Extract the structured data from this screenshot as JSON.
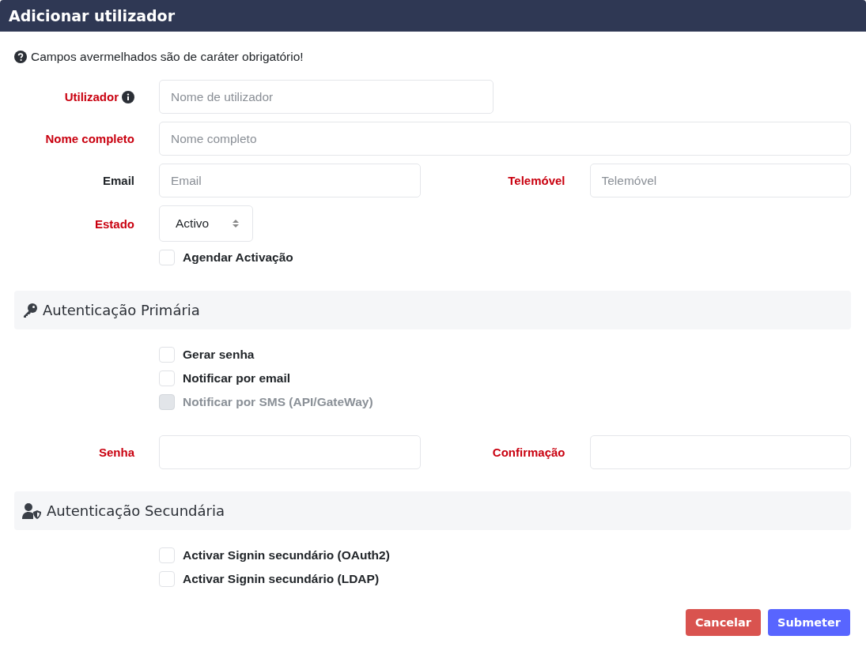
{
  "window": {
    "title": "Adicionar utilizador"
  },
  "note": "Campos avermelhados são de caráter obrigatório!",
  "rows": [
    {
      "kind": "short",
      "fields": [
        {
          "label": "Utilizador",
          "required": true,
          "info": true,
          "placeholder": "Nome de utilizador"
        }
      ]
    },
    {
      "kind": "full",
      "fields": [
        {
          "label": "Nome completo",
          "required": true,
          "placeholder": "Nome completo"
        }
      ]
    },
    {
      "kind": "pair",
      "fields": [
        {
          "label": "Email",
          "required": false,
          "placeholder": "Email"
        },
        {
          "label": "Telemóvel",
          "required": true,
          "placeholder": "Telemóvel"
        }
      ]
    },
    {
      "kind": "select",
      "fields": [
        {
          "label": "Estado",
          "required": true,
          "value": "Activo"
        }
      ]
    }
  ],
  "checkboxes": [
    {
      "label": "Agendar Activação",
      "checked": false,
      "disabled": false
    }
  ],
  "sections": [
    {
      "title": "Autenticação Primária",
      "checkboxes": [
        {
          "label": "Gerar senha",
          "checked": false,
          "disabled": false
        },
        {
          "label": "Notificar por email",
          "checked": false,
          "disabled": false
        },
        {
          "label": "Notificar por SMS (API/GateWay)",
          "checked": false,
          "disabled": true
        }
      ],
      "rows": [
        {
          "kind": "pair",
          "fields": [
            {
              "label": "Senha",
              "required": true
            },
            {
              "label": "Confirmação",
              "required": true
            }
          ]
        }
      ]
    },
    {
      "title": "Autenticação Secundária",
      "checkboxes": [
        {
          "label": "Activar Signin secundário (OAuth2)",
          "checked": false,
          "disabled": false
        },
        {
          "label": "Activar Signin secundário (LDAP)",
          "checked": false,
          "disabled": false
        }
      ]
    }
  ],
  "buttons": [
    {
      "label": "Cancelar",
      "kind": "danger"
    },
    {
      "label": "Submeter",
      "kind": "primary"
    }
  ]
}
